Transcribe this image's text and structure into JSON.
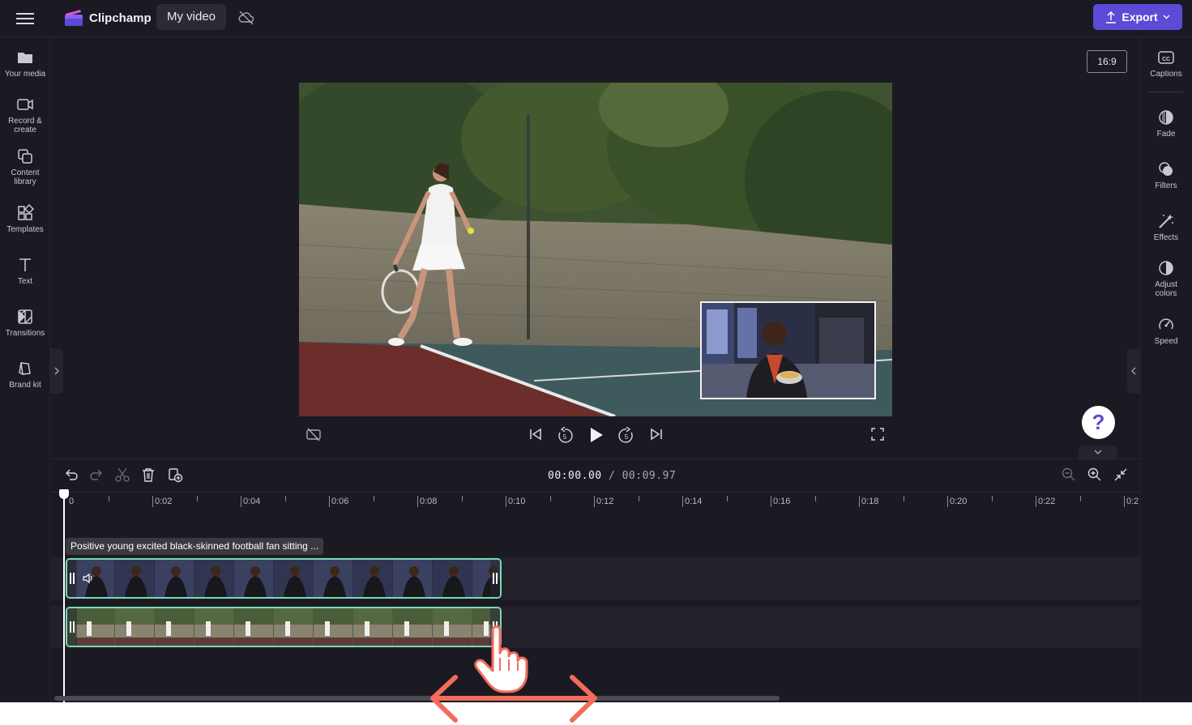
{
  "app": {
    "name": "Clipchamp",
    "project_title": "My video",
    "export_label": "Export"
  },
  "colors": {
    "accent": "#5b4bd6",
    "clip_border": "#7ad9b1",
    "background": "#1b1a22",
    "drag_arrow": "#f26b5b"
  },
  "left_sidebar": {
    "items": [
      {
        "label": "Your media",
        "icon": "folder-icon"
      },
      {
        "label": "Record & create",
        "icon": "camera-icon"
      },
      {
        "label": "Content library",
        "icon": "library-icon"
      },
      {
        "label": "Templates",
        "icon": "templates-icon"
      },
      {
        "label": "Text",
        "icon": "text-icon"
      },
      {
        "label": "Transitions",
        "icon": "transitions-icon"
      },
      {
        "label": "Brand kit",
        "icon": "brand-kit-icon"
      }
    ]
  },
  "right_sidebar": {
    "items": [
      {
        "label": "Captions",
        "icon": "captions-icon"
      },
      {
        "label": "Fade",
        "icon": "fade-icon"
      },
      {
        "label": "Filters",
        "icon": "filters-icon"
      },
      {
        "label": "Effects",
        "icon": "effects-icon"
      },
      {
        "label": "Adjust colors",
        "icon": "adjust-colors-icon"
      },
      {
        "label": "Speed",
        "icon": "speed-icon"
      }
    ]
  },
  "preview": {
    "aspect_ratio": "16:9",
    "help_label": "?"
  },
  "timeline": {
    "current_time": "00:00.00",
    "separator": "/",
    "total_time": "00:09.97",
    "ruler_labels": [
      "0",
      "0:02",
      "0:04",
      "0:06",
      "0:08",
      "0:10",
      "0:12",
      "0:14",
      "0:16",
      "0:18",
      "0:20",
      "0:22",
      "0:2"
    ],
    "clips": [
      {
        "title": "Positive young excited black-skinned football fan sitting ...",
        "track": "overlay"
      },
      {
        "title": "",
        "track": "main"
      }
    ]
  }
}
